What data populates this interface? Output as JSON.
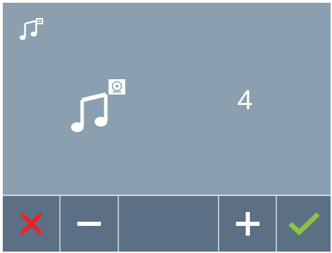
{
  "screen": {
    "header_icon": "music-note-with-tone-badge-icon",
    "center_icon": "music-note-with-speaker-badge-icon",
    "value": "4"
  },
  "toolbar": {
    "cancel_icon": "red-x-icon",
    "minus_icon": "minus-icon",
    "plus_icon": "plus-icon",
    "confirm_icon": "green-checkmark-icon"
  },
  "colors": {
    "background": "#8a9fb0",
    "toolbar": "#5b7084",
    "cancel": "#e8232a",
    "confirm": "#8cc63f",
    "foreground": "#ffffff"
  }
}
